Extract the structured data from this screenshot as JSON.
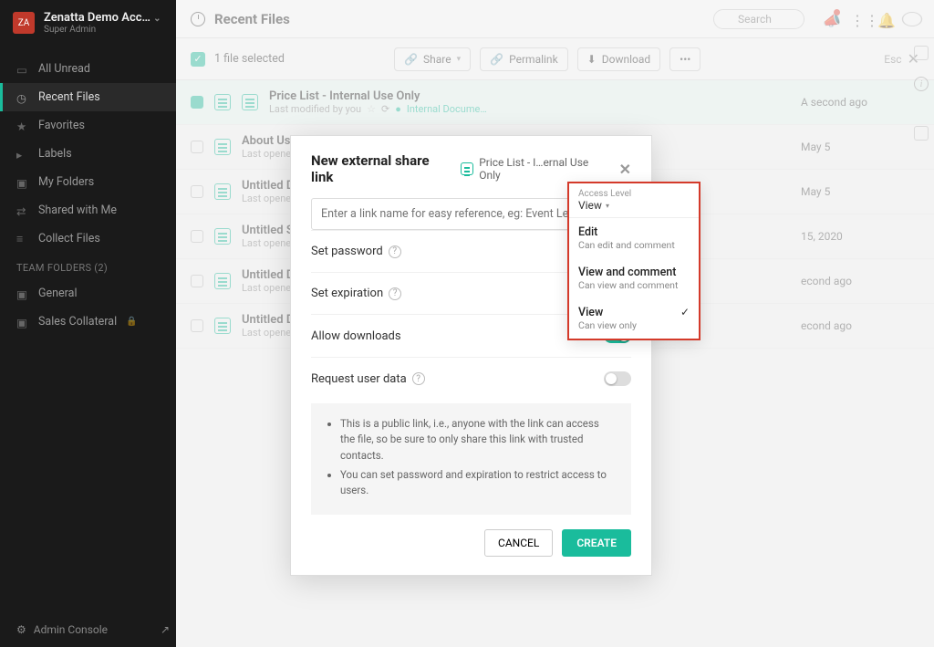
{
  "account": {
    "badge": "ZA",
    "name": "Zenatta Demo Acc…",
    "role": "Super Admin"
  },
  "nav": [
    {
      "icon": "inbox",
      "label": "All Unread"
    },
    {
      "icon": "clock",
      "label": "Recent Files"
    },
    {
      "icon": "star",
      "label": "Favorites"
    },
    {
      "icon": "tag",
      "label": "Labels"
    },
    {
      "icon": "folder",
      "label": "My Folders"
    },
    {
      "icon": "share",
      "label": "Shared with Me"
    },
    {
      "icon": "collect",
      "label": "Collect Files"
    }
  ],
  "team_header": "TEAM FOLDERS (2)",
  "team": [
    {
      "label": "General"
    },
    {
      "label": "Sales Collateral"
    }
  ],
  "admin": "Admin Console",
  "header": {
    "title": "Recent Files",
    "search_placeholder": "Search"
  },
  "toolbar": {
    "selected": "1 file selected",
    "share": "Share",
    "permalink": "Permalink",
    "download": "Download",
    "more": "•••",
    "esc": "Esc"
  },
  "files": [
    {
      "name": "Price List - Internal Use Only",
      "sub_prefix": "Last modified by you",
      "perm": "Internal Docume…",
      "date": "A second ago",
      "selected": true,
      "starred": true
    },
    {
      "name": "About Us",
      "sub_prefix": "Last opened b",
      "date": "May 5"
    },
    {
      "name": "Untitled Doc",
      "sub_prefix": "Last opened b",
      "date": "May 5"
    },
    {
      "name": "Untitled Spr",
      "sub_prefix": "Last opened b",
      "date": "15, 2020"
    },
    {
      "name": "Untitled Doc",
      "sub_prefix": "Last opened b",
      "date": "econd ago"
    },
    {
      "name": "Untitled Doc",
      "sub_prefix": "Last opened b",
      "date": "econd ago"
    }
  ],
  "modal": {
    "title": "New external share link",
    "file": "Price List - I…ernal Use Only",
    "link_placeholder": "Enter a link name for easy reference, eg: Event Leads",
    "opts": {
      "password": "Set password",
      "expiration": "Set expiration",
      "downloads": "Allow downloads",
      "userdata": "Request user data"
    },
    "notes": [
      "This is a public link, i.e., anyone with the link can access the file, so be sure to only share this link with trusted contacts.",
      "You can set password and expiration to restrict access to users."
    ],
    "cancel": "CANCEL",
    "create": "CREATE"
  },
  "dropdown": {
    "label": "Access Level",
    "selected": "View",
    "items": [
      {
        "t": "Edit",
        "d": "Can edit and comment"
      },
      {
        "t": "View and comment",
        "d": "Can view and comment"
      },
      {
        "t": "View",
        "d": "Can view only",
        "sel": true
      }
    ]
  }
}
